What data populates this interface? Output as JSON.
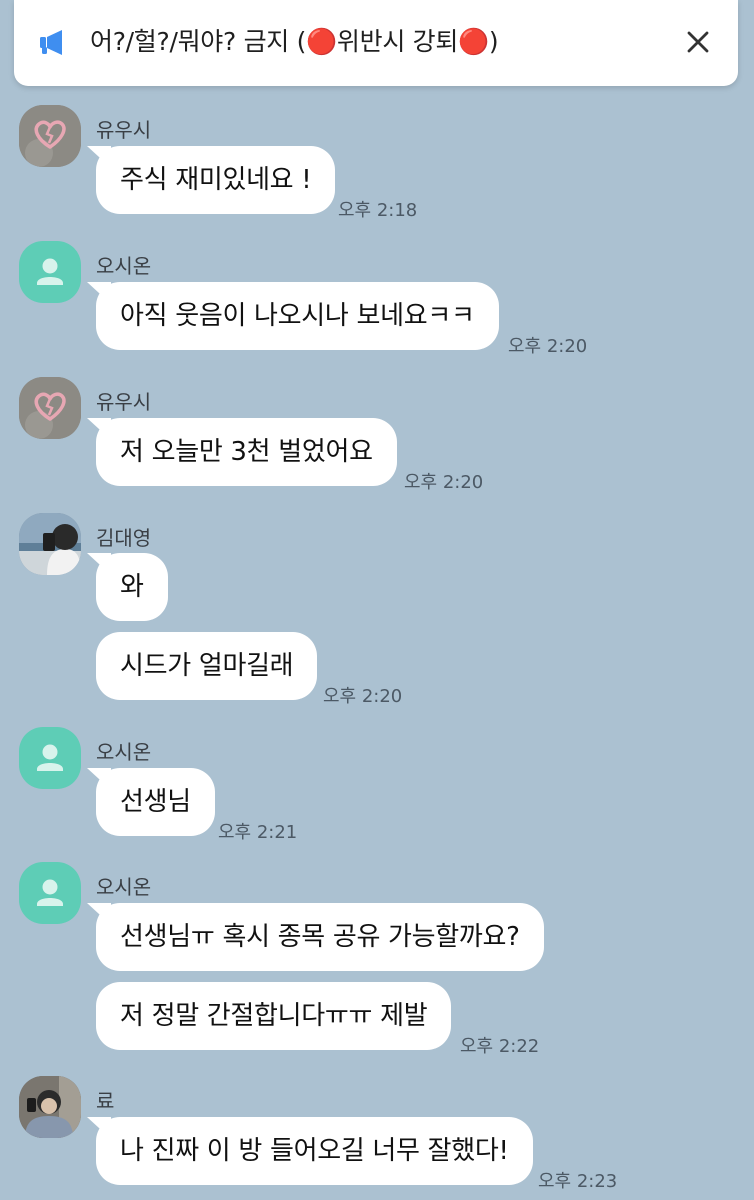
{
  "notice": {
    "icon": "megaphone-icon",
    "text": "어?/헐?/뭐야? 금지 (🔴위반시 강퇴🔴)",
    "close_icon": "close-icon",
    "accent": "#3f8ef0"
  },
  "messages": [
    {
      "sender": "유우시",
      "avatar": "broken-heart-avatar",
      "bubbles": [
        "주식 재미있네요 !"
      ],
      "time": "오후 2:18"
    },
    {
      "sender": "오시온",
      "avatar": "default-person-avatar",
      "bubbles": [
        "아직 웃음이 나오시나 보네요ㅋㅋ"
      ],
      "time": "오후 2:20"
    },
    {
      "sender": "유우시",
      "avatar": "broken-heart-avatar",
      "bubbles": [
        "저 오늘만 3천 벌었어요"
      ],
      "time": "오후 2:20"
    },
    {
      "sender": "김대영",
      "avatar": "photo-avatar",
      "bubbles": [
        "와",
        "시드가 얼마길래"
      ],
      "time": "오후 2:20"
    },
    {
      "sender": "오시온",
      "avatar": "default-person-avatar",
      "bubbles": [
        "선생님"
      ],
      "time": "오후 2:21"
    },
    {
      "sender": "오시온",
      "avatar": "default-person-avatar",
      "bubbles": [
        "선생님ㅠ 혹시 종목 공유 가능할까요?",
        "저 정말 간절합니다ㅠㅠ 제발"
      ],
      "time": "오후 2:22"
    },
    {
      "sender": "료",
      "avatar": "photo-avatar",
      "bubbles": [
        "나 진짜 이 방 들어오길 너무 잘했다!"
      ],
      "time": "오후 2:23"
    }
  ],
  "colors": {
    "background": "#abc1d1",
    "bubble": "#ffffff",
    "default_avatar": "#5ecdb6"
  }
}
